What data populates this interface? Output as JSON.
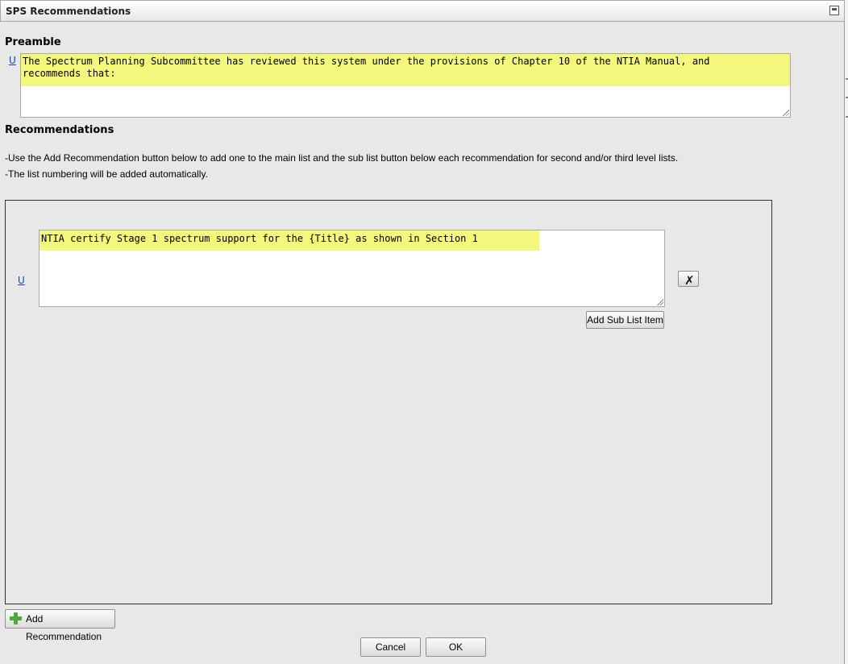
{
  "window": {
    "title": "SPS Recommendations"
  },
  "preamble": {
    "heading": "Preamble",
    "link_label": "U",
    "text": "The Spectrum Planning Subcommittee has reviewed this system under the provisions of Chapter 10 of the NTIA Manual, and\nrecommends that:"
  },
  "recommendations": {
    "heading": "Recommendations",
    "instructions": [
      "-Use the Add Recommendation button below to add one to the main list and the sub list button below each recommendation for second and/or third level lists.",
      "-The list numbering will be added automatically."
    ],
    "items": [
      {
        "link_label": "U",
        "text": "NTIA certify Stage 1 spectrum support for the {Title} as shown in Section 1",
        "sub_list_button": "Add Sub List Item"
      }
    ],
    "add_button": "Add Recommendation"
  },
  "footer": {
    "cancel": "Cancel",
    "ok": "OK"
  },
  "colors": {
    "highlight": "#f4f77c",
    "link": "#1a3ec4",
    "add_icon": "#4cab3a"
  },
  "icons": {
    "collapse": "collapse-icon",
    "delete": "delete-x-icon",
    "add": "plus-icon"
  }
}
